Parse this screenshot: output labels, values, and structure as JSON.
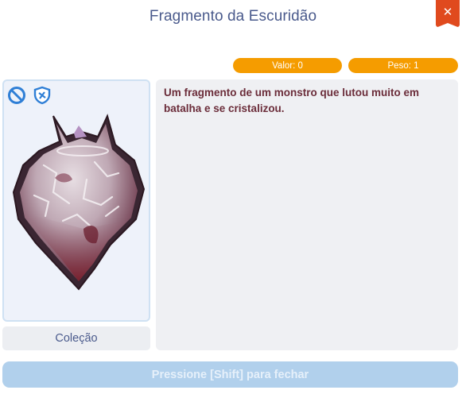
{
  "dialog": {
    "title": "Fragmento da Escuridão",
    "close_icon": "close-icon"
  },
  "stats": {
    "value_label": "Valor: 0",
    "weight_label": "Peso: 1"
  },
  "item": {
    "icons": [
      "no-trade-icon",
      "shield-icon"
    ],
    "art": "dark-fragment-crystal",
    "description": "Um fragmento de um monstro que lutou muito em batalha e se cristalizou."
  },
  "collection_button": "Coleção",
  "footer_hint": "Pressione [Shift] para fechar",
  "colors": {
    "title": "#4a5a8c",
    "close": "#e04a1e",
    "pill": "#f59c00",
    "description_text": "#6b2d3a",
    "footer_button": "#b1d0ec"
  }
}
